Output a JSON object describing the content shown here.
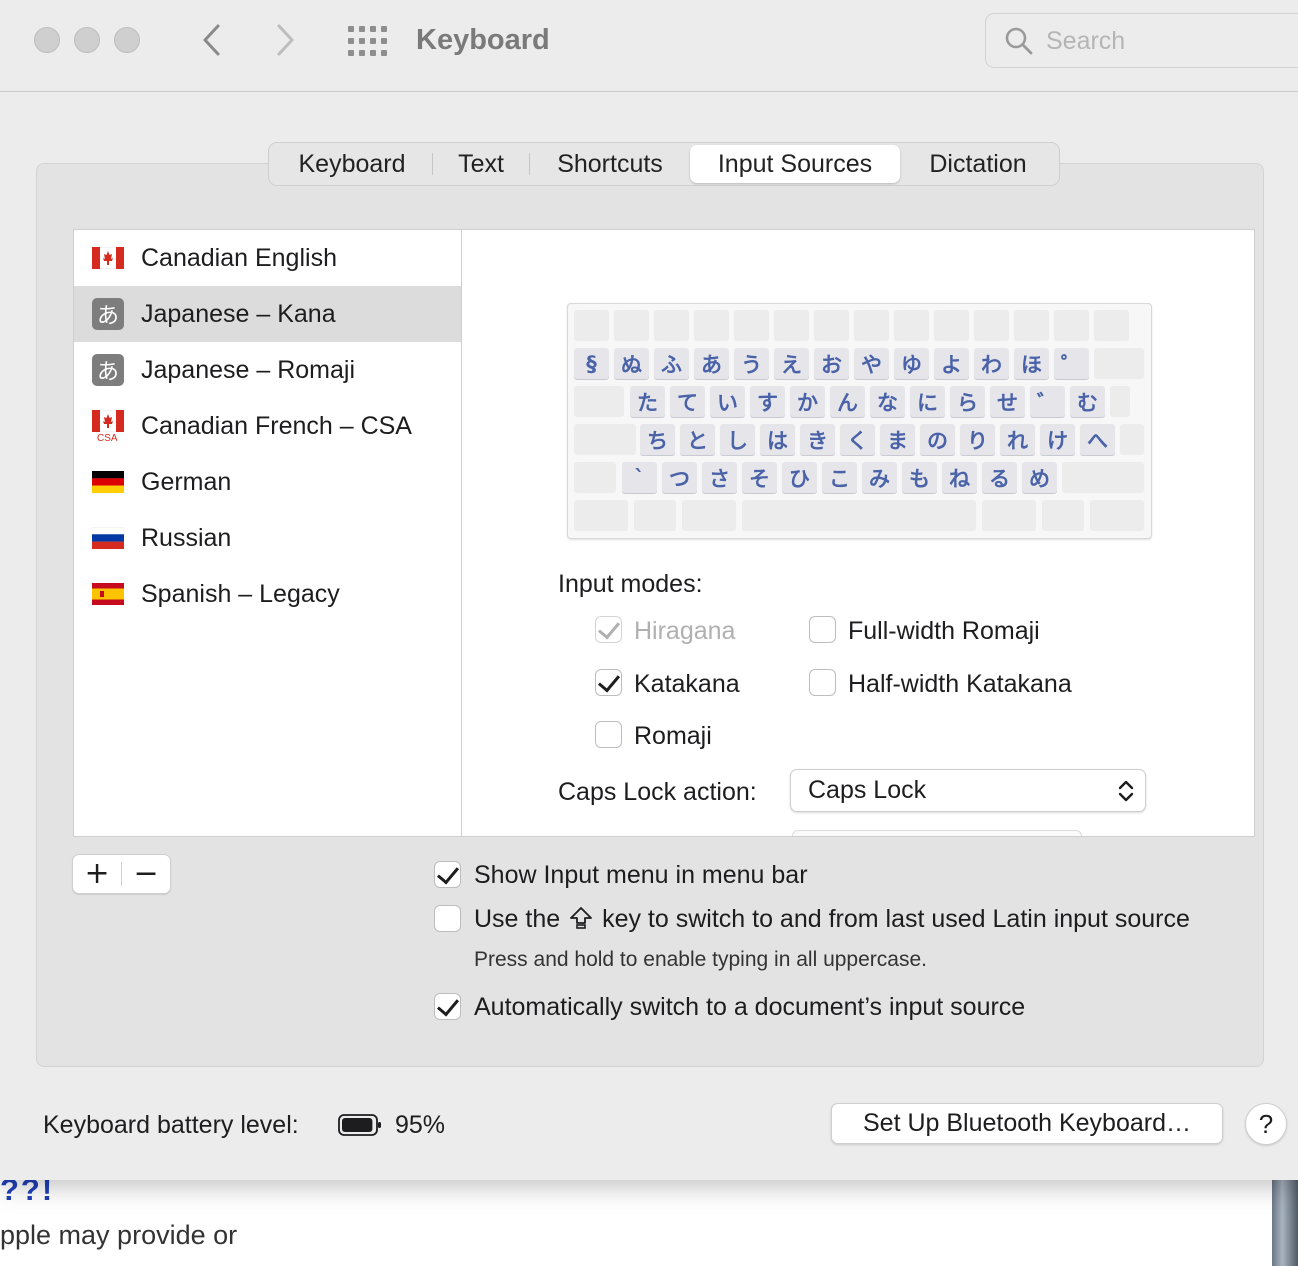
{
  "window": {
    "title": "Keyboard",
    "search_placeholder": "Search"
  },
  "tabs": [
    {
      "label": "Keyboard",
      "active": false
    },
    {
      "label": "Text",
      "active": false
    },
    {
      "label": "Shortcuts",
      "active": false
    },
    {
      "label": "Input Sources",
      "active": true
    },
    {
      "label": "Dictation",
      "active": false
    }
  ],
  "sources": [
    {
      "label": "Canadian English",
      "icon": "canada-flag-icon",
      "selected": false
    },
    {
      "label": "Japanese – Kana",
      "icon": "kana-icon",
      "selected": true
    },
    {
      "label": "Japanese – Romaji",
      "icon": "kana-icon",
      "selected": false
    },
    {
      "label": "Canadian French – CSA",
      "icon": "canada-csa-flag-icon",
      "selected": false
    },
    {
      "label": "German",
      "icon": "germany-flag-icon",
      "selected": false
    },
    {
      "label": "Russian",
      "icon": "russia-flag-icon",
      "selected": false
    },
    {
      "label": "Spanish – Legacy",
      "icon": "spain-flag-icon",
      "selected": false
    }
  ],
  "kana_icon_glyph": "あ",
  "csa_tag": "CSA",
  "keyboard_rows": {
    "row1": [
      "§",
      "ぬ",
      "ふ",
      "あ",
      "う",
      "え",
      "お",
      "や",
      "ゆ",
      "よ",
      "わ",
      "ほ",
      "゜"
    ],
    "row2": [
      "た",
      "て",
      "い",
      "す",
      "か",
      "ん",
      "な",
      "に",
      "ら",
      "せ",
      "゛",
      "む"
    ],
    "row3": [
      "ち",
      "と",
      "し",
      "は",
      "き",
      "く",
      "ま",
      "の",
      "り",
      "れ",
      "け",
      "へ"
    ],
    "row4": [
      "`",
      "つ",
      "さ",
      "そ",
      "ひ",
      "こ",
      "み",
      "も",
      "ね",
      "る",
      "め"
    ]
  },
  "input_modes": {
    "title": "Input modes:",
    "hiragana": {
      "label": "Hiragana",
      "checked": true,
      "disabled": true
    },
    "katakana": {
      "label": "Katakana",
      "checked": true
    },
    "romaji": {
      "label": "Romaji",
      "checked": false
    },
    "full_width_romaji": {
      "label": "Full-width Romaji",
      "checked": false
    },
    "half_width_katakana": {
      "label": "Half-width Katakana",
      "checked": false
    }
  },
  "caps_lock": {
    "label": "Caps Lock action:",
    "value": "Caps Lock"
  },
  "list_buttons": {
    "add": "+",
    "remove": "−"
  },
  "options": {
    "show_input_menu": {
      "label": "Show Input menu in menu bar",
      "checked": true
    },
    "use_caps_key_pre": "Use the",
    "use_caps_key_post": "key to switch to and from last used Latin input source",
    "use_caps_key_checked": false,
    "use_caps_hint": "Press and hold to enable typing in all uppercase.",
    "auto_switch": {
      "label": "Automatically switch to a document’s input source",
      "checked": true
    }
  },
  "battery": {
    "label": "Keyboard battery level:",
    "value": "95%",
    "level": 0.95
  },
  "bluetooth_button": "Set Up Bluetooth Keyboard…",
  "help_button": "?",
  "background_page": {
    "heading": "??!",
    "text": "pple may provide or"
  }
}
